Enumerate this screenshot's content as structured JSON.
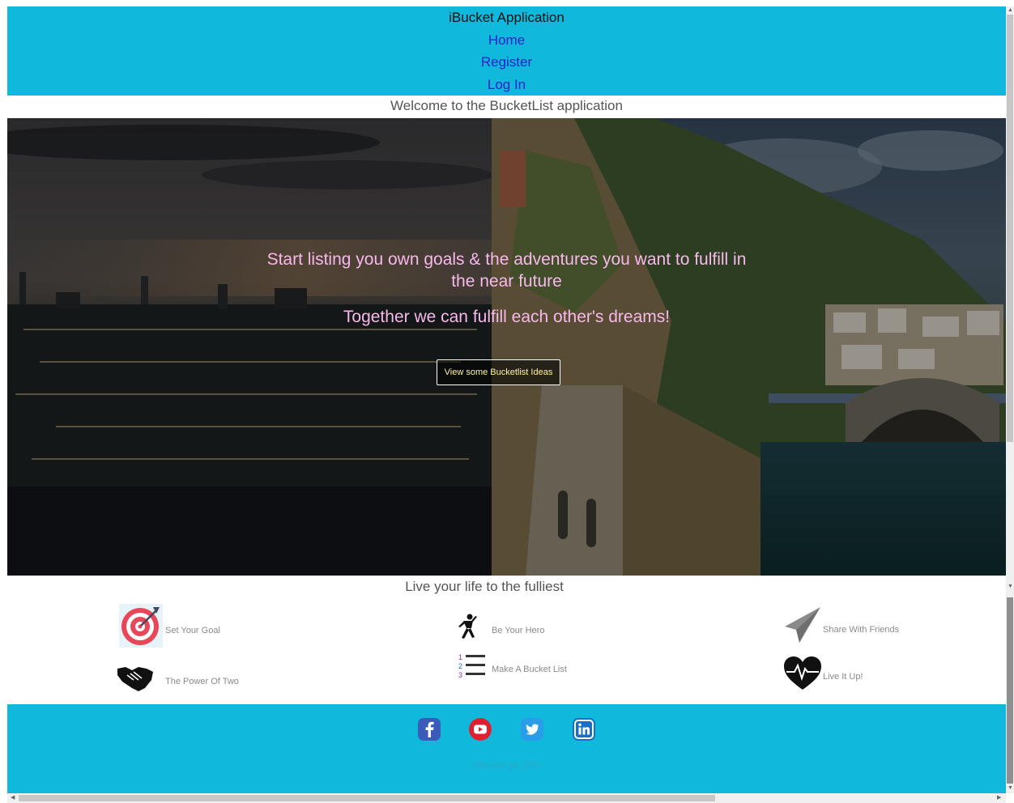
{
  "header": {
    "app_title": "iBucket Application",
    "nav": {
      "home": "Home",
      "register": "Register",
      "login": "Log In"
    }
  },
  "welcome": "Welcome to the BucketList application",
  "hero": {
    "line1": "Start listing you own goals & the adventures you want to fulfill in",
    "line2": "the near future",
    "line3": "Together we can fulfill each other's dreams!",
    "button": "View some Bucketlist Ideas"
  },
  "features": {
    "tagline": "Live your life to the fulliest",
    "items": [
      {
        "label": "Set Your Goal",
        "icon": "target-icon"
      },
      {
        "label": "Be Your Hero",
        "icon": "hero-icon"
      },
      {
        "label": "Share With Friends",
        "icon": "paper-plane-icon"
      },
      {
        "label": "The Power Of Two",
        "icon": "handshake-icon"
      },
      {
        "label": "Make A Bucket List",
        "icon": "numbered-list-icon"
      },
      {
        "label": "Live It Up!",
        "icon": "heartbeat-icon"
      }
    ]
  },
  "footer": {
    "social": [
      "facebook-icon",
      "youtube-icon",
      "twitter-icon",
      "linkedin-icon"
    ],
    "copyright": "©Bucket list 2020"
  },
  "colors": {
    "header_bg": "#10b8dc",
    "nav_link": "#2a22c9",
    "hero_text": "#f7b8ea",
    "button_text": "#fff59a"
  }
}
